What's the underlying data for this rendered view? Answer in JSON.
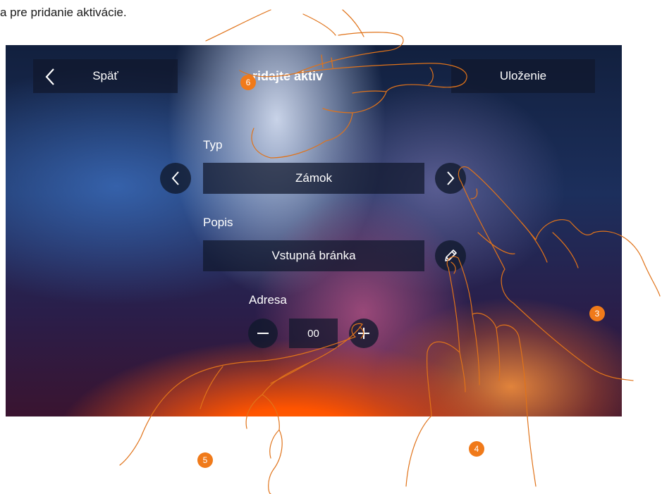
{
  "caption": "a pre pridanie aktivácie.",
  "header": {
    "back_label": "Späť",
    "title": "ridajte aktiv",
    "save_label": "Uloženie"
  },
  "form": {
    "type": {
      "label": "Typ",
      "value": "Zámok"
    },
    "description": {
      "label": "Popis",
      "value": "Vstupná bránka"
    },
    "address": {
      "label": "Adresa",
      "value": "00"
    }
  },
  "steps": {
    "step_3": "3",
    "step_4": "4",
    "step_5": "5",
    "step_6": "6"
  },
  "colors": {
    "step_marker": "#f07a1a",
    "hand_outline": "#e0731a",
    "panel": "#10182c"
  },
  "icons": {
    "back": "chevron-left-icon",
    "type_prev": "chevron-left-icon",
    "type_next": "chevron-right-icon",
    "edit": "pencil-icon",
    "decrement": "minus-icon",
    "increment": "plus-icon"
  }
}
